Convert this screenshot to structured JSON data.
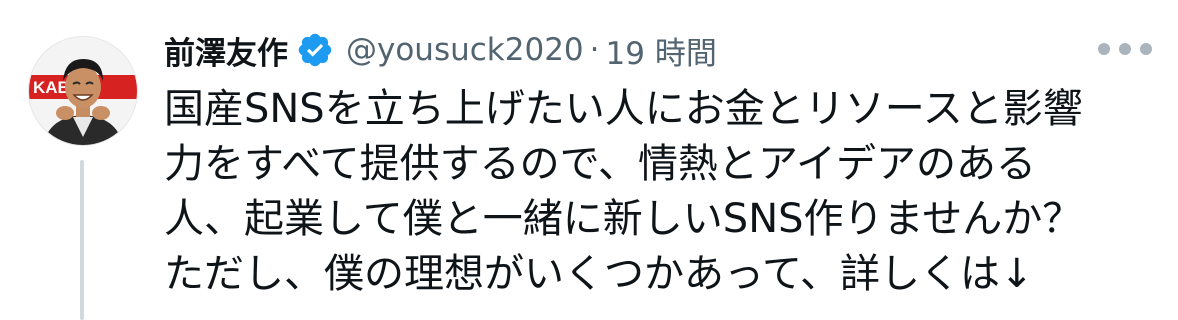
{
  "tweet": {
    "display_name": "前澤友作",
    "handle": "@yousuck2020",
    "separator": "·",
    "time": "19 時間",
    "avatar_sign_text": "KABU&",
    "body_lines": [
      "国産SNSを立ち上げたい人にお金とリソースと影響",
      "力をすべて提供するので、情熱とアイデアのある",
      "人、起業して僕と一緒に新しいSNS作りませんか？",
      "ただし、僕の理想がいくつかあって、詳しくは↓"
    ]
  },
  "icons": {
    "verified": "verified-badge-icon",
    "more": "more-options-icon"
  },
  "colors": {
    "text": "#0f1419",
    "secondary": "#536471",
    "verified": "#1d9bf0",
    "thread_line": "#cfd9de",
    "avatar_sign": "#d72222"
  }
}
